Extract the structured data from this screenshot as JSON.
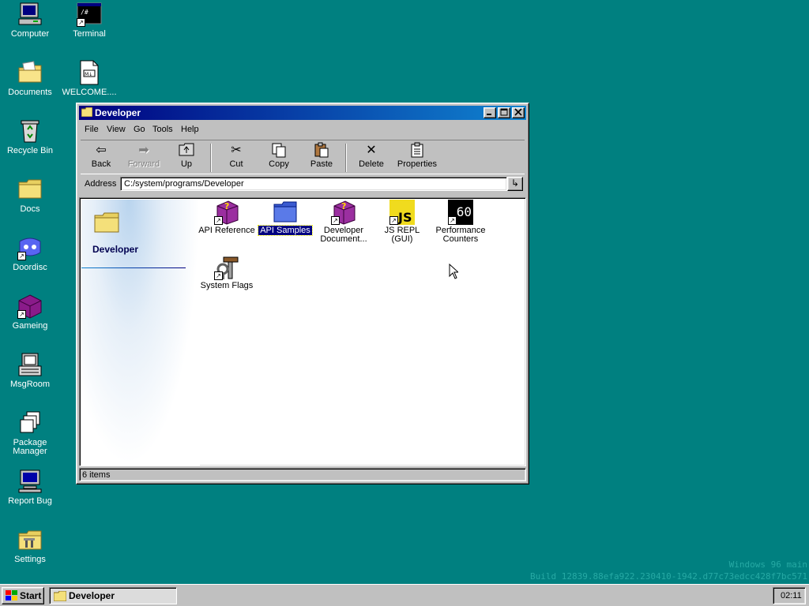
{
  "desktop": {
    "icons": [
      {
        "label": "Computer"
      },
      {
        "label": "Terminal"
      },
      {
        "label": "Documents"
      },
      {
        "label": "WELCOME...."
      },
      {
        "label": "Recycle Bin"
      },
      {
        "label": "Docs"
      },
      {
        "label": "Doordisc"
      },
      {
        "label": "Gameing"
      },
      {
        "label": "MsgRoom"
      },
      {
        "label": "Package Manager"
      },
      {
        "label": "Report Bug"
      },
      {
        "label": "Settings"
      }
    ]
  },
  "window": {
    "title": "Developer",
    "menu": [
      "File",
      "View",
      "Go",
      "Tools",
      "Help"
    ],
    "toolbar": {
      "back": "Back",
      "forward": "Forward",
      "up": "Up",
      "cut": "Cut",
      "copy": "Copy",
      "paste": "Paste",
      "delete": "Delete",
      "properties": "Properties"
    },
    "address": {
      "label": "Address",
      "value": "C:/system/programs/Developer"
    },
    "sidepanel_title": "Developer",
    "files": [
      {
        "label": "API Reference",
        "icon": "help-book-icon"
      },
      {
        "label": "API Samples",
        "icon": "folder-icon",
        "selected": true
      },
      {
        "label": "Developer Document...",
        "icon": "help-book-icon"
      },
      {
        "label": "JS REPL (GUI)",
        "icon": "js-icon"
      },
      {
        "label": "Performance Counters",
        "icon": "fps-counter-icon",
        "icon_text": "60"
      },
      {
        "label": "System Flags",
        "icon": "tools-icon"
      }
    ],
    "status": "6 items"
  },
  "taskbar": {
    "start": "Start",
    "task": "Developer",
    "clock": "02:11"
  },
  "watermark": {
    "line1": "Windows 96 main",
    "line2": "Build 12839.88efa922.230410-1942.d77c73edcc428f7bc571"
  },
  "colors": {
    "desktop": "#008080",
    "titlebar": "#000080",
    "selection": "#000080"
  }
}
